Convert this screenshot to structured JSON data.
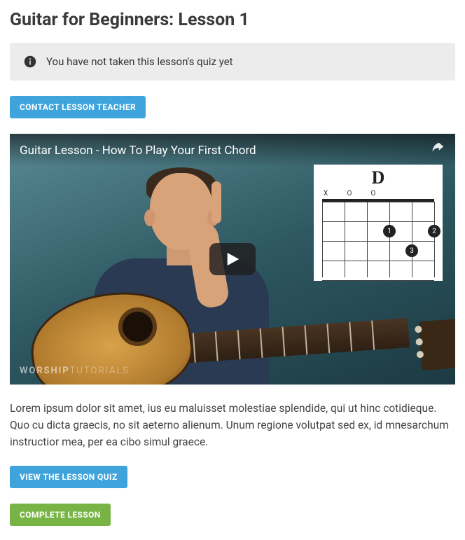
{
  "page": {
    "title": "Guitar for Beginners: Lesson 1"
  },
  "notice": {
    "text": "You have not taken this lesson's quiz yet"
  },
  "buttons": {
    "contact_teacher": "Contact Lesson Teacher",
    "view_quiz": "View the Lesson Quiz",
    "complete_lesson": "Complete Lesson"
  },
  "video": {
    "title": "Guitar Lesson - How To Play Your First Chord",
    "watermark_a": "WORSHIP",
    "watermark_b": "TUTORIALS",
    "chord": {
      "name": "D",
      "top_marks": [
        "X",
        "O",
        "O",
        "",
        "",
        ""
      ],
      "dots": [
        {
          "string": 3,
          "fret": 2,
          "label": "1"
        },
        {
          "string": 5,
          "fret": 2,
          "label": "2"
        },
        {
          "string": 4,
          "fret": 3,
          "label": "3"
        }
      ]
    }
  },
  "description": "Lorem ipsum dolor sit amet, ius eu maluisset molestiae splendide, qui ut hinc cotidieque. Quo cu dicta graecis, no sit aeterno alienum. Unum regione volutpat sed ex, id mnesarchum instruc­tior mea, per ea cibo simul graece."
}
